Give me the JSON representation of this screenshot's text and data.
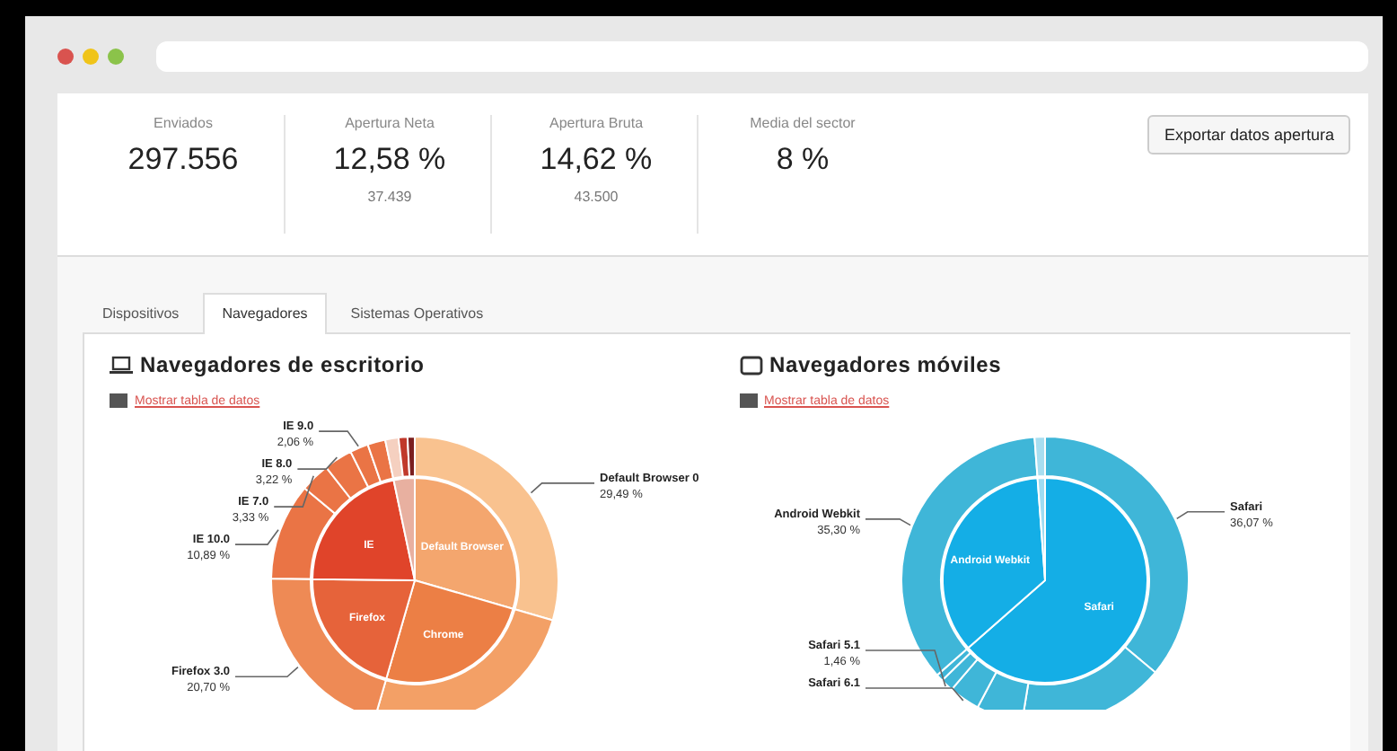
{
  "browser": {
    "traffic_lights": [
      {
        "color": "#d9534f"
      },
      {
        "color": "#f0c419"
      },
      {
        "color": "#8bc34a"
      }
    ]
  },
  "stats": [
    {
      "label": "Enviados",
      "value": "297.556"
    },
    {
      "label": "Apertura Neta",
      "value": "12,58 %",
      "sub": "37.439"
    },
    {
      "label": "Apertura Bruta",
      "value": "14,62 %",
      "sub": "43.500"
    },
    {
      "label": "Media del sector",
      "value": "8 %"
    }
  ],
  "export_button": "Exportar datos apertura",
  "tabs": [
    {
      "label": "Dispositivos",
      "selected": false
    },
    {
      "label": "Navegadores",
      "selected": true
    },
    {
      "label": "Sistemas Operativos",
      "selected": false
    }
  ],
  "panels": [
    {
      "title": "Navegadores de escritorio",
      "kind": "desktop",
      "link": "Mostrar tabla de datos",
      "rings": [
        {
          "chart_data": {
            "type": "pie",
            "categories": [
              "Default Browser",
              "Chrome",
              "Firefox",
              "IE",
              null
            ],
            "values": [
              29.49,
              25.0,
              20.7,
              21.5,
              3.31
            ],
            "colors": [
              "#f4a66e",
              "#ec7f45",
              "#e6633a",
              "#e0442a",
              "#e8b0a0"
            ]
          }
        },
        {
          "chart_data": {
            "type": "donut",
            "categories": [
              "Default Browser 0",
              null,
              "Firefox 3.0",
              "IE 10.0",
              "IE 7.0",
              "IE 8.0",
              "IE 9.0",
              null,
              null,
              null,
              null
            ],
            "values": [
              29.49,
              25.0,
              20.7,
              10.89,
              3.33,
              3.22,
              2.06,
              2.0,
              1.5,
              1.0,
              0.81
            ],
            "value_labels": [
              "29,49 %",
              null,
              "20,70 %",
              "10,89 %",
              "3,33 %",
              "3,22 %",
              "2,06 %",
              null,
              null,
              null,
              null
            ],
            "colors": [
              "#f9c28f",
              "#f3a066",
              "#ee8a55",
              "#ea7445",
              "#ea7445",
              "#ea7445",
              "#ea7445",
              "#ea7445",
              "#f5d0c0",
              "#c0392b",
              "#7b1f1f"
            ]
          }
        }
      ]
    },
    {
      "title": "Navegadores móviles",
      "kind": "mobile",
      "link": "Mostrar tabla de datos",
      "rings": [
        {
          "chart_data": {
            "type": "pie",
            "categories": [
              "Safari",
              "Android Webkit",
              null
            ],
            "values": [
              63.53,
              35.3,
              1.17
            ],
            "colors": [
              "#14aee6",
              "#14aee6",
              "#9fdcf2"
            ]
          }
        },
        {
          "chart_data": {
            "type": "donut",
            "categories": [
              "Safari",
              null,
              null,
              "Safari 6.1",
              "Safari 5.1",
              null,
              "Android Webkit",
              null
            ],
            "values": [
              36.07,
              16.5,
              5.2,
              3.5,
              1.46,
              0.8,
              35.3,
              1.17
            ],
            "value_labels": [
              "36,07 %",
              null,
              null,
              null,
              "1,46 %",
              null,
              "35,30 %",
              null
            ],
            "colors": [
              "#3fb6d8",
              "#3fb6d8",
              "#3fb6d8",
              "#3fb6d8",
              "#3fb6d8",
              "#3fb6d8",
              "#3fb6d8",
              "#a8def0"
            ]
          }
        }
      ]
    }
  ]
}
